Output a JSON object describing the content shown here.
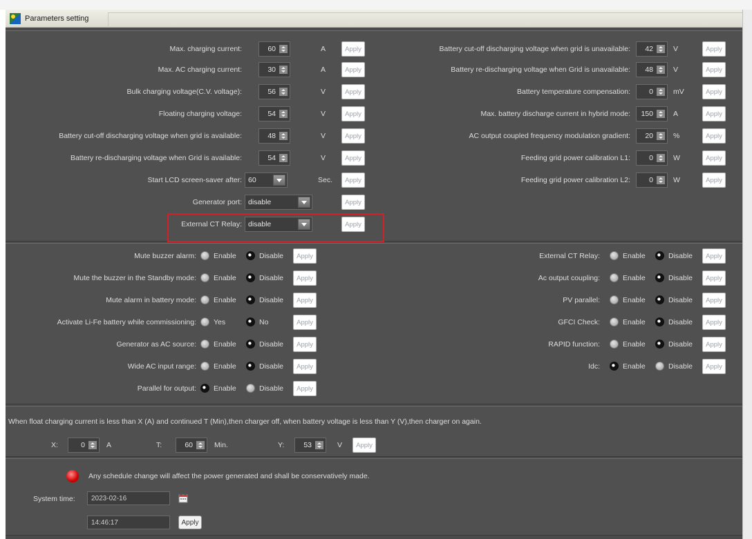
{
  "window": {
    "title": "Parameters setting"
  },
  "section1": {
    "left": [
      {
        "label": "Max. charging current:",
        "value": "60",
        "unit": "A"
      },
      {
        "label": "Max. AC charging current:",
        "value": "30",
        "unit": "A"
      },
      {
        "label": "Bulk charging voltage(C.V. voltage):",
        "value": "56",
        "unit": "V"
      },
      {
        "label": "Floating charging voltage:",
        "value": "54",
        "unit": "V"
      },
      {
        "label": "Battery cut-off discharging voltage when grid is available:",
        "value": "48",
        "unit": "V"
      },
      {
        "label": "Battery re-discharging voltage when Grid is available:",
        "value": "54",
        "unit": "V"
      }
    ],
    "lcd": {
      "label": "Start LCD screen-saver after:",
      "value": "60",
      "unit": "Sec."
    },
    "generator": {
      "label": "Generator port:",
      "value": "disable"
    },
    "ct_relay": {
      "label": "External CT  Relay:",
      "value": "disable"
    },
    "right": [
      {
        "label": "Battery cut-off discharging voltage when grid is unavailable:",
        "value": "42",
        "unit": "V"
      },
      {
        "label": "Battery re-discharging voltage when Grid is unavailable:",
        "value": "48",
        "unit": "V"
      },
      {
        "label": "Battery temperature compensation:",
        "value": "0",
        "unit": "mV"
      },
      {
        "label": "Max. battery discharge current in hybrid mode:",
        "value": "150",
        "unit": "A"
      },
      {
        "label": "AC output coupled frequency modulation gradient:",
        "value": "20",
        "unit": "%"
      },
      {
        "label": "Feeding grid power calibration L1:",
        "value": "0",
        "unit": "W"
      },
      {
        "label": "Feeding grid power calibration L2:",
        "value": "0",
        "unit": "W"
      }
    ],
    "apply_label": "Apply",
    "highlight_color": "#d32027"
  },
  "section2": {
    "left": [
      {
        "label": "Mute buzzer alarm:",
        "opt1": "Enable",
        "opt2": "Disable",
        "selected": 2
      },
      {
        "label": "Mute the buzzer in the Standby mode:",
        "opt1": "Enable",
        "opt2": "Disable",
        "selected": 2
      },
      {
        "label": "Mute alarm in battery mode:",
        "opt1": "Enable",
        "opt2": "Disable",
        "selected": 2
      },
      {
        "label": "Activate Li-Fe battery while commissioning:",
        "opt1": "Yes",
        "opt2": "No",
        "selected": 2
      },
      {
        "label": "Generator as AC source:",
        "opt1": "Enable",
        "opt2": "Disable",
        "selected": 2
      },
      {
        "label": "Wide AC input range:",
        "opt1": "Enable",
        "opt2": "Disable",
        "selected": 2
      },
      {
        "label": "Parallel for output:",
        "opt1": "Enable",
        "opt2": "Disable",
        "selected": 1
      }
    ],
    "right": [
      {
        "label": "External CT  Relay:",
        "opt1": "Enable",
        "opt2": "Disable",
        "selected": 2
      },
      {
        "label": "Ac output coupling:",
        "opt1": "Enable",
        "opt2": "Disable",
        "selected": 2
      },
      {
        "label": "PV parallel:",
        "opt1": "Enable",
        "opt2": "Disable",
        "selected": 2
      },
      {
        "label": "GFCI Check:",
        "opt1": "Enable",
        "opt2": "Disable",
        "selected": 2
      },
      {
        "label": "RAPID function:",
        "opt1": "Enable",
        "opt2": "Disable",
        "selected": 2
      },
      {
        "label": "Idc:",
        "opt1": "Enable",
        "opt2": "Disable",
        "selected": 1
      }
    ]
  },
  "section3": {
    "sentence": "When float charging current is less than X (A) and continued T (Min),then charger off, when battery voltage is less than Y (V),then charger on again.",
    "x": {
      "label": "X:",
      "value": "0",
      "unit": "A"
    },
    "t": {
      "label": "T:",
      "value": "60",
      "unit": "Min."
    },
    "y": {
      "label": "Y:",
      "value": "53",
      "unit": "V"
    }
  },
  "section4": {
    "warning": "Any schedule change will affect the power generated and shall be conservatively made.",
    "system_time_label": "System time:",
    "date": "2023-02-16",
    "time": "14:46:17",
    "apply_label": "Apply"
  }
}
